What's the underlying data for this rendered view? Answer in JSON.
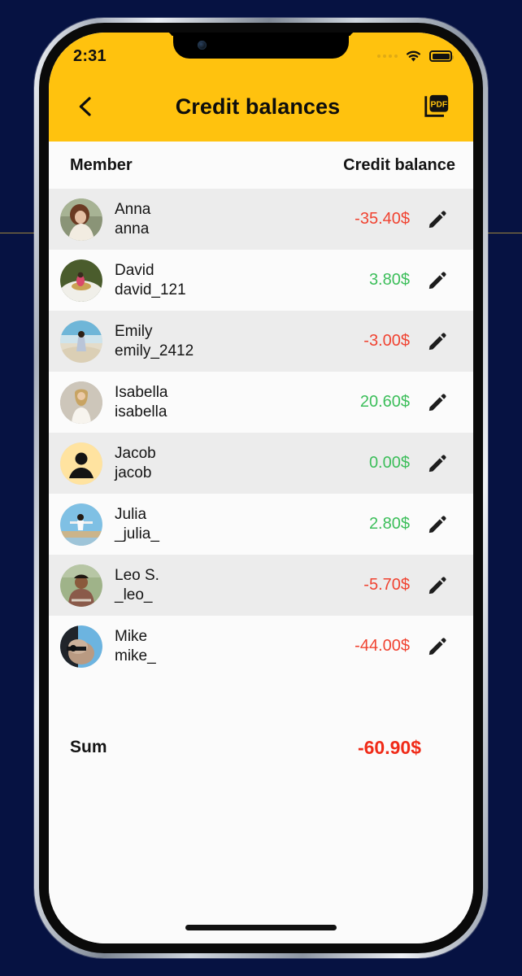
{
  "statusbar": {
    "time": "2:31",
    "signal_icon": "signal-dots-icon",
    "wifi_icon": "wifi-icon",
    "battery_icon": "battery-full-icon"
  },
  "navbar": {
    "back_icon": "chevron-left-icon",
    "title": "Credit balances",
    "pdf_label": "PDF",
    "pdf_icon": "pdf-export-icon"
  },
  "table": {
    "columns": [
      "Member",
      "Credit balance"
    ],
    "rows": [
      {
        "name": "Anna",
        "username": "anna",
        "amount": "-35.40$",
        "sign": "neg",
        "avatar": "photo",
        "edit_icon": "pencil-icon"
      },
      {
        "name": "David",
        "username": "david_121",
        "amount": "3.80$",
        "sign": "pos",
        "avatar": "photo",
        "edit_icon": "pencil-icon"
      },
      {
        "name": "Emily",
        "username": "emily_2412",
        "amount": "-3.00$",
        "sign": "neg",
        "avatar": "photo",
        "edit_icon": "pencil-icon"
      },
      {
        "name": "Isabella",
        "username": "isabella",
        "amount": "20.60$",
        "sign": "pos",
        "avatar": "photo",
        "edit_icon": "pencil-icon"
      },
      {
        "name": "Jacob",
        "username": "jacob",
        "amount": "0.00$",
        "sign": "pos",
        "avatar": "default-person",
        "edit_icon": "pencil-icon"
      },
      {
        "name": "Julia",
        "username": "_julia_",
        "amount": "2.80$",
        "sign": "pos",
        "avatar": "photo",
        "edit_icon": "pencil-icon"
      },
      {
        "name": "Leo S.",
        "username": "_leo_",
        "amount": "-5.70$",
        "sign": "neg",
        "avatar": "photo",
        "edit_icon": "pencil-icon"
      },
      {
        "name": "Mike",
        "username": "mike_",
        "amount": "-44.00$",
        "sign": "neg",
        "avatar": "photo",
        "edit_icon": "pencil-icon"
      }
    ]
  },
  "summary": {
    "label": "Sum",
    "value": "-60.90$"
  },
  "colors": {
    "accent_yellow": "#FFC20E",
    "negative": "#F04331",
    "positive": "#3CBE5A",
    "sum_negative": "#F02B18",
    "row_alt": "#ECECEC",
    "row_plain": "#FBFBFB",
    "backdrop": "#061242"
  }
}
